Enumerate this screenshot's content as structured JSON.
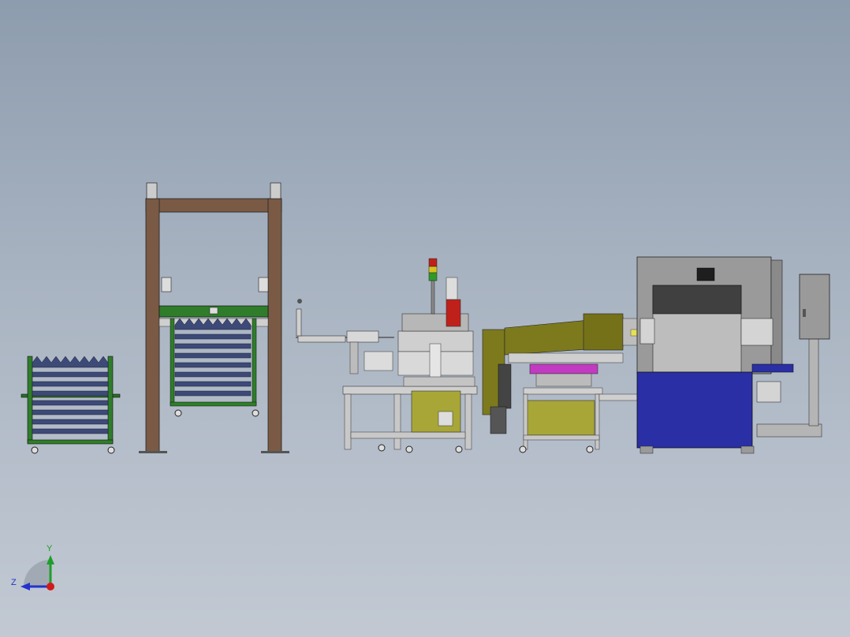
{
  "colors": {
    "background_top": "#8d9cae",
    "background_bottom": "#c2c9d3",
    "frame_wood": "#7a5a45",
    "rack_green": "#2f7d2a",
    "tray_navy": "#3d4a78",
    "machine_olive": "#7d7a1e",
    "machine_blue": "#2a2fa6",
    "enclosure_gray": "#9a9a9a",
    "accent_magenta": "#c23ac2",
    "signal_red": "#c0201a"
  },
  "equipment": [
    {
      "id": "cart-left",
      "icon": "tray-cart"
    },
    {
      "id": "gantry-stacker",
      "icon": "gantry-frame"
    },
    {
      "id": "feeder-conveyor",
      "icon": "conveyor"
    },
    {
      "id": "rotary-station",
      "icon": "rotary-table"
    },
    {
      "id": "olive-press",
      "icon": "press-unit"
    },
    {
      "id": "main-machine",
      "icon": "enclosure"
    }
  ],
  "triad": {
    "y_label": "Y",
    "z_label": "Z"
  }
}
